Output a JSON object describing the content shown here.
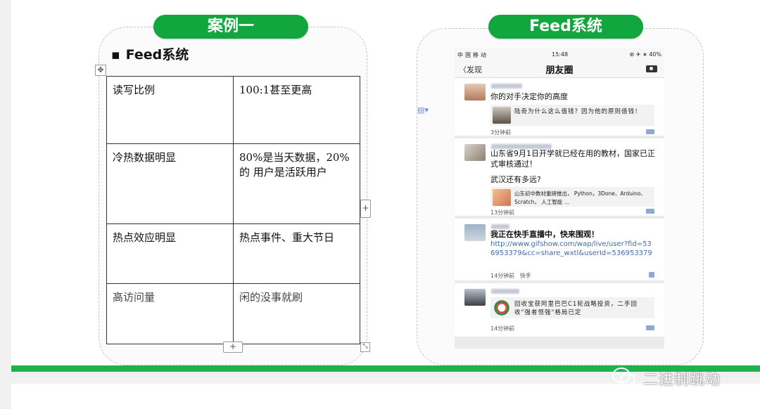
{
  "left_slide": {
    "pill": "案例一",
    "bullet": "▪",
    "heading": "Feed系统",
    "table": [
      [
        "读写比例",
        "100:1甚至更高"
      ],
      [
        "冷热数据明显",
        "80%是当天数据，20%的 用户是活跃用户"
      ],
      [
        "热点效应明显",
        "热点事件、重大节日"
      ],
      [
        "高访问量",
        "闲的没事就刷"
      ]
    ],
    "move_handle": "✥",
    "resize_handle": "⤡",
    "add_row": "+",
    "add_col": "+"
  },
  "right_slide": {
    "pill": "Feed系统",
    "phone": {
      "carrier": "中国移动",
      "time": "15:48",
      "battery": "⊛ ✈ ∗ 40%",
      "back": "〈发现",
      "title": "朋友圈",
      "posts": [
        {
          "text": "你的对手决定你的高度",
          "share_text": "陆奇为什么这么值钱？因为他的原则值钱！",
          "time": "3分钟前"
        },
        {
          "text": "山东省9月1日开学就已经在用的教材，国家已正式审核通过！",
          "text2": "武汉还有多远?",
          "share_text": "山东初中数材重磅推出， Python，3Done、Arduino、Scratch，      人工智能 …",
          "time": "13分钟前"
        },
        {
          "text": "我正在快手直播中，快来围观！",
          "link": "http://www.gifshow.com/wap/live/user?fid=536953379&cc=share_wxtl&userId=536953379",
          "time": "14分钟前",
          "source": "快手"
        },
        {
          "share_text": "回收宝获阿里巴巴C1轮战略投资，二手回收\"强者恒强\"格局已定",
          "time": "14分钟前"
        }
      ]
    }
  },
  "watermark": "二进制跳动",
  "colors": {
    "accent_green": "#12a63f",
    "bar_green": "#1fb14a",
    "link_blue": "#3e6aa8"
  },
  "icons": [
    "move-icon",
    "resize-icon",
    "plus-icon",
    "document-icon",
    "camera-icon",
    "comment-icon",
    "wechat-icon"
  ]
}
